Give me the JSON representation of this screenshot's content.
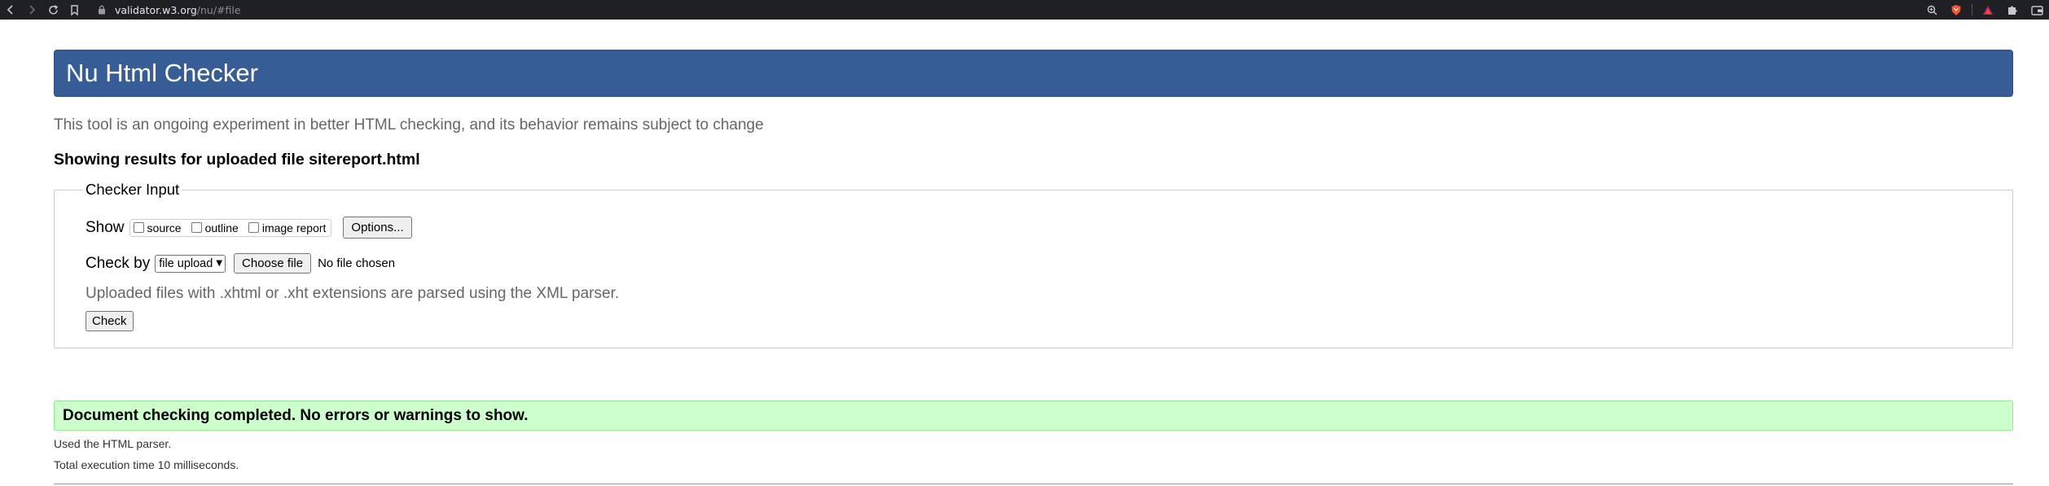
{
  "browser": {
    "url_host": "validator.w3.org",
    "url_path": "/nu/#file",
    "icons": {
      "back": "back-arrow-icon",
      "forward": "forward-arrow-icon",
      "reload": "reload-icon",
      "bookmark": "bookmark-icon",
      "lock": "lock-icon",
      "zoom": "zoom-icon",
      "brave": "brave-shield-icon",
      "rewards": "brave-rewards-icon",
      "extensions": "extensions-puzzle-icon",
      "wallet": "wallet-icon"
    }
  },
  "header": {
    "title": "Nu Html Checker"
  },
  "tagline": "This tool is an ongoing experiment in better HTML checking, and its behavior remains subject to change",
  "result_heading": "Showing results for uploaded file sitereport.html",
  "checker_input": {
    "legend": "Checker Input",
    "show_label": "Show",
    "show_options": [
      {
        "label": "source",
        "checked": false
      },
      {
        "label": "outline",
        "checked": false
      },
      {
        "label": "image report",
        "checked": false
      }
    ],
    "options_button": "Options...",
    "check_by_label": "Check by",
    "check_by_selected": "file upload",
    "choose_file_button": "Choose file",
    "no_file_text": "No file chosen",
    "note": "Uploaded files with .xhtml or .xht extensions are parsed using the XML parser.",
    "check_button": "Check"
  },
  "success_message": "Document checking completed. No errors or warnings to show.",
  "parser_note": "Used the HTML parser.",
  "execution_time": "Total execution time 10 milliseconds.",
  "colors": {
    "header_bg": "#365d95",
    "success_bg": "#ccffcc",
    "browser_bar": "#1f2024"
  }
}
